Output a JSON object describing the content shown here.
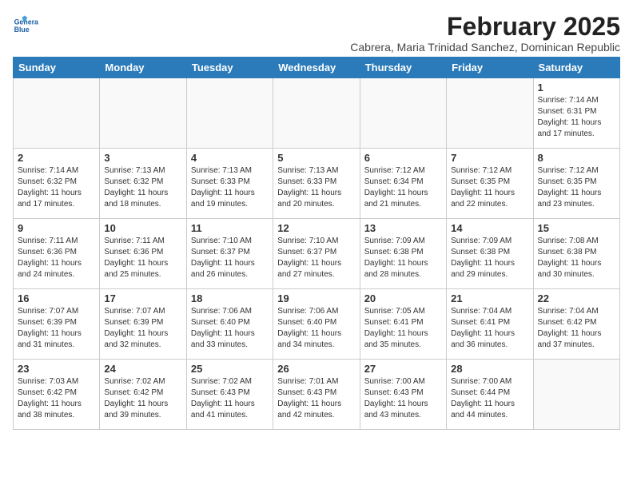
{
  "header": {
    "logo_line1": "General",
    "logo_line2": "Blue",
    "month": "February 2025",
    "location": "Cabrera, Maria Trinidad Sanchez, Dominican Republic"
  },
  "weekdays": [
    "Sunday",
    "Monday",
    "Tuesday",
    "Wednesday",
    "Thursday",
    "Friday",
    "Saturday"
  ],
  "weeks": [
    [
      {
        "day": "",
        "info": ""
      },
      {
        "day": "",
        "info": ""
      },
      {
        "day": "",
        "info": ""
      },
      {
        "day": "",
        "info": ""
      },
      {
        "day": "",
        "info": ""
      },
      {
        "day": "",
        "info": ""
      },
      {
        "day": "1",
        "info": "Sunrise: 7:14 AM\nSunset: 6:31 PM\nDaylight: 11 hours and 17 minutes."
      }
    ],
    [
      {
        "day": "2",
        "info": "Sunrise: 7:14 AM\nSunset: 6:32 PM\nDaylight: 11 hours and 17 minutes."
      },
      {
        "day": "3",
        "info": "Sunrise: 7:13 AM\nSunset: 6:32 PM\nDaylight: 11 hours and 18 minutes."
      },
      {
        "day": "4",
        "info": "Sunrise: 7:13 AM\nSunset: 6:33 PM\nDaylight: 11 hours and 19 minutes."
      },
      {
        "day": "5",
        "info": "Sunrise: 7:13 AM\nSunset: 6:33 PM\nDaylight: 11 hours and 20 minutes."
      },
      {
        "day": "6",
        "info": "Sunrise: 7:12 AM\nSunset: 6:34 PM\nDaylight: 11 hours and 21 minutes."
      },
      {
        "day": "7",
        "info": "Sunrise: 7:12 AM\nSunset: 6:35 PM\nDaylight: 11 hours and 22 minutes."
      },
      {
        "day": "8",
        "info": "Sunrise: 7:12 AM\nSunset: 6:35 PM\nDaylight: 11 hours and 23 minutes."
      }
    ],
    [
      {
        "day": "9",
        "info": "Sunrise: 7:11 AM\nSunset: 6:36 PM\nDaylight: 11 hours and 24 minutes."
      },
      {
        "day": "10",
        "info": "Sunrise: 7:11 AM\nSunset: 6:36 PM\nDaylight: 11 hours and 25 minutes."
      },
      {
        "day": "11",
        "info": "Sunrise: 7:10 AM\nSunset: 6:37 PM\nDaylight: 11 hours and 26 minutes."
      },
      {
        "day": "12",
        "info": "Sunrise: 7:10 AM\nSunset: 6:37 PM\nDaylight: 11 hours and 27 minutes."
      },
      {
        "day": "13",
        "info": "Sunrise: 7:09 AM\nSunset: 6:38 PM\nDaylight: 11 hours and 28 minutes."
      },
      {
        "day": "14",
        "info": "Sunrise: 7:09 AM\nSunset: 6:38 PM\nDaylight: 11 hours and 29 minutes."
      },
      {
        "day": "15",
        "info": "Sunrise: 7:08 AM\nSunset: 6:38 PM\nDaylight: 11 hours and 30 minutes."
      }
    ],
    [
      {
        "day": "16",
        "info": "Sunrise: 7:07 AM\nSunset: 6:39 PM\nDaylight: 11 hours and 31 minutes."
      },
      {
        "day": "17",
        "info": "Sunrise: 7:07 AM\nSunset: 6:39 PM\nDaylight: 11 hours and 32 minutes."
      },
      {
        "day": "18",
        "info": "Sunrise: 7:06 AM\nSunset: 6:40 PM\nDaylight: 11 hours and 33 minutes."
      },
      {
        "day": "19",
        "info": "Sunrise: 7:06 AM\nSunset: 6:40 PM\nDaylight: 11 hours and 34 minutes."
      },
      {
        "day": "20",
        "info": "Sunrise: 7:05 AM\nSunset: 6:41 PM\nDaylight: 11 hours and 35 minutes."
      },
      {
        "day": "21",
        "info": "Sunrise: 7:04 AM\nSunset: 6:41 PM\nDaylight: 11 hours and 36 minutes."
      },
      {
        "day": "22",
        "info": "Sunrise: 7:04 AM\nSunset: 6:42 PM\nDaylight: 11 hours and 37 minutes."
      }
    ],
    [
      {
        "day": "23",
        "info": "Sunrise: 7:03 AM\nSunset: 6:42 PM\nDaylight: 11 hours and 38 minutes."
      },
      {
        "day": "24",
        "info": "Sunrise: 7:02 AM\nSunset: 6:42 PM\nDaylight: 11 hours and 39 minutes."
      },
      {
        "day": "25",
        "info": "Sunrise: 7:02 AM\nSunset: 6:43 PM\nDaylight: 11 hours and 41 minutes."
      },
      {
        "day": "26",
        "info": "Sunrise: 7:01 AM\nSunset: 6:43 PM\nDaylight: 11 hours and 42 minutes."
      },
      {
        "day": "27",
        "info": "Sunrise: 7:00 AM\nSunset: 6:43 PM\nDaylight: 11 hours and 43 minutes."
      },
      {
        "day": "28",
        "info": "Sunrise: 7:00 AM\nSunset: 6:44 PM\nDaylight: 11 hours and 44 minutes."
      },
      {
        "day": "",
        "info": ""
      }
    ]
  ]
}
